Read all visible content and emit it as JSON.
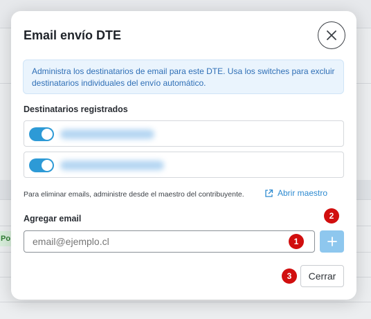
{
  "modal": {
    "title": "Email envío DTE",
    "info_text": "Administra los destinatarios de email para este DTE. Usa los switches para excluir destinatarios individuales del envío automático.",
    "registered_label": "Destinatarios registrados",
    "recipients": [
      {
        "enabled": true
      },
      {
        "enabled": true
      }
    ],
    "note": "Para eliminar emails, administre desde el maestro del contribuyente.",
    "master_link": "Abrir maestro",
    "add_label": "Agregar email",
    "email_input": {
      "placeholder": "email@ejemplo.cl",
      "value": ""
    },
    "close_label": "Cerrar"
  },
  "badges": [
    "1",
    "2",
    "3"
  ],
  "background": {
    "pill_text": "Po"
  },
  "colors": {
    "accent": "#2d9ad6",
    "add_button": "#8ec7ee",
    "badge": "#d10e0e",
    "info_bg": "#eaf4fd",
    "info_text": "#2f6fb6"
  },
  "icons": {
    "close": "close-icon",
    "external_link": "external-link-icon",
    "add": "plus-icon"
  }
}
